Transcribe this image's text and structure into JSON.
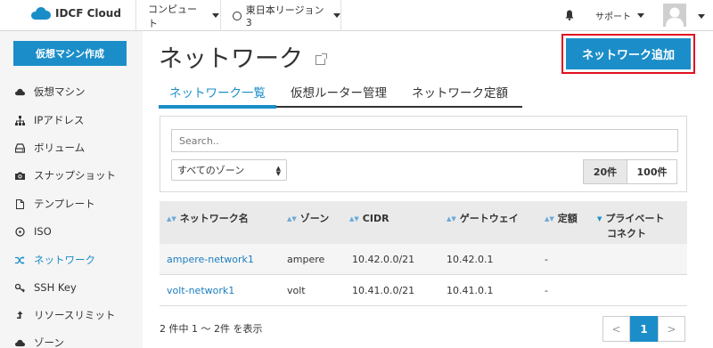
{
  "header": {
    "logo_text": "IDCF Cloud",
    "compute_label": "コンピュート",
    "region_label": "東日本リージョン3",
    "support_label": "サポート"
  },
  "sidebar": {
    "create_button": "仮想マシン作成",
    "items": [
      {
        "label": "仮想マシン",
        "icon": "cloud-icon"
      },
      {
        "label": "IPアドレス",
        "icon": "network-tree-icon"
      },
      {
        "label": "ボリューム",
        "icon": "hdd-icon"
      },
      {
        "label": "スナップショット",
        "icon": "camera-icon"
      },
      {
        "label": "テンプレート",
        "icon": "file-icon"
      },
      {
        "label": "ISO",
        "icon": "disc-icon"
      },
      {
        "label": "ネットワーク",
        "icon": "shuffle-icon",
        "active": true
      },
      {
        "label": "SSH Key",
        "icon": "key-icon"
      },
      {
        "label": "リソースリミット",
        "icon": "upload-icon"
      },
      {
        "label": "ゾーン",
        "icon": "cloud-icon"
      }
    ]
  },
  "main": {
    "title": "ネットワーク",
    "add_button": "ネットワーク追加",
    "tabs": [
      {
        "label": "ネットワーク一覧",
        "active": true
      },
      {
        "label": "仮想ルーター管理"
      },
      {
        "label": "ネットワーク定額"
      }
    ],
    "search_placeholder": "Search..",
    "zone_select": "すべてのゾーン",
    "page_sizes": [
      "20件",
      "100件"
    ],
    "table": {
      "headers": [
        "ネットワーク名",
        "ゾーン",
        "CIDR",
        "ゲートウェイ",
        "定額",
        "プライベート",
        "コネクト"
      ],
      "rows": [
        {
          "name": "ampere-network1",
          "zone": "ampere",
          "cidr": "10.42.0.0/21",
          "gateway": "10.42.0.1",
          "flat": "-",
          "private": ""
        },
        {
          "name": "volt-network1",
          "zone": "volt",
          "cidr": "10.41.0.0/21",
          "gateway": "10.41.0.1",
          "flat": "-",
          "private": ""
        }
      ]
    },
    "count_text": "2 件中 1 ～ 2件 を表示",
    "pager": {
      "prev": "<",
      "current": "1",
      "next": ">"
    }
  },
  "colors": {
    "accent": "#1b8ec9",
    "highlight": "#e01020"
  }
}
